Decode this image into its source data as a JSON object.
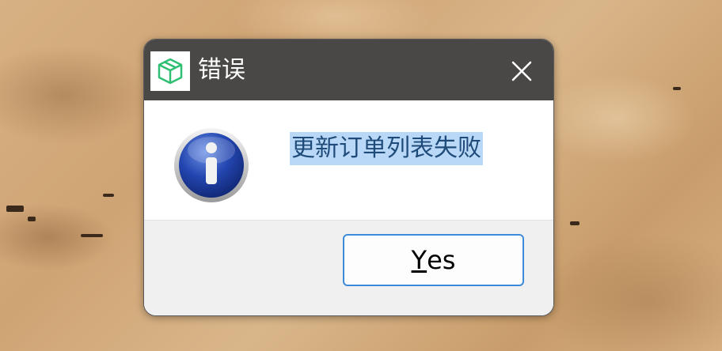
{
  "dialog": {
    "title": "错误",
    "message": "更新订单列表失败",
    "buttons": {
      "yes_mnemonic": "Y",
      "yes_rest": "es"
    },
    "icons": {
      "app": "package-box-icon",
      "close": "close-icon",
      "message_type": "info-icon"
    },
    "colors": {
      "titlebar": "#4a4846",
      "accent": "#3d8bd8",
      "selection": "#b9d8f7"
    }
  }
}
